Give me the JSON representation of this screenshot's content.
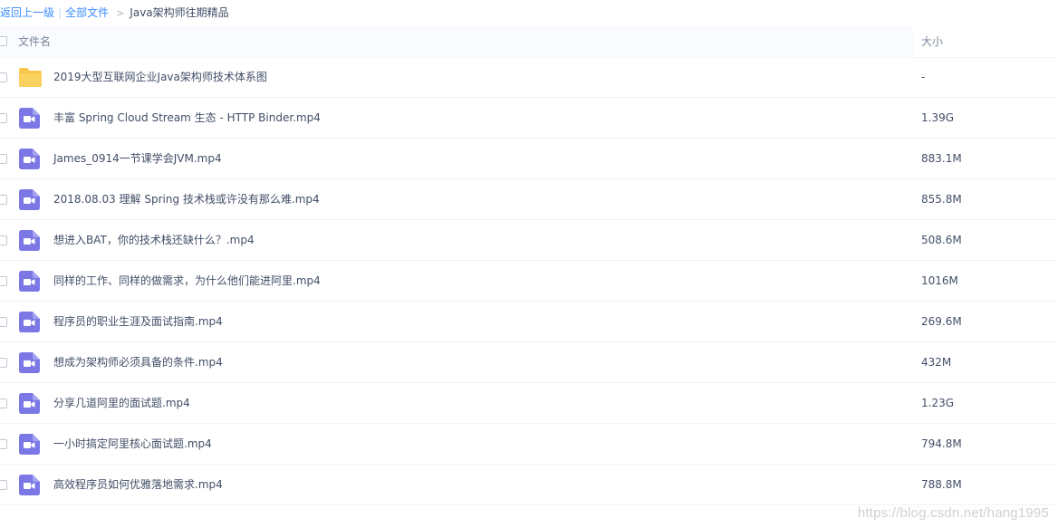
{
  "breadcrumb": {
    "back": "返回上一级",
    "separator": "|",
    "all_files": "全部文件",
    "arrow": ">",
    "current": "Java架构师往期精品"
  },
  "header": {
    "name_label": "文件名",
    "size_label": "大小"
  },
  "colors": {
    "link": "#3b8cff",
    "folder": "#f7c64a",
    "video": "#7b78e6",
    "header_bg": "#f9fbff"
  },
  "files": [
    {
      "name": "2019大型互联网企业Java架构师技术体系图",
      "size": "-",
      "icon": "folder-icon"
    },
    {
      "name": "丰富 Spring Cloud Stream 生态 - HTTP Binder.mp4",
      "size": "1.39G",
      "icon": "video-file-icon"
    },
    {
      "name": "James_0914一节课学会JVM.mp4",
      "size": "883.1M",
      "icon": "video-file-icon"
    },
    {
      "name": "2018.08.03 理解 Spring 技术栈或许没有那么难.mp4",
      "size": "855.8M",
      "icon": "video-file-icon"
    },
    {
      "name": "想进入BAT，你的技术栈还缺什么？.mp4",
      "size": "508.6M",
      "icon": "video-file-icon"
    },
    {
      "name": "同样的工作、同样的做需求，为什么他们能进阿里.mp4",
      "size": "1016M",
      "icon": "video-file-icon"
    },
    {
      "name": "程序员的职业生涯及面试指南.mp4",
      "size": "269.6M",
      "icon": "video-file-icon"
    },
    {
      "name": "想成为架构师必须具备的条件.mp4",
      "size": "432M",
      "icon": "video-file-icon"
    },
    {
      "name": "分享几道阿里的面试题.mp4",
      "size": "1.23G",
      "icon": "video-file-icon"
    },
    {
      "name": "一小时搞定阿里核心面试题.mp4",
      "size": "794.8M",
      "icon": "video-file-icon"
    },
    {
      "name": "高效程序员如何优雅落地需求.mp4",
      "size": "788.8M",
      "icon": "video-file-icon"
    }
  ],
  "watermark": "https://blog.csdn.net/hang1995"
}
